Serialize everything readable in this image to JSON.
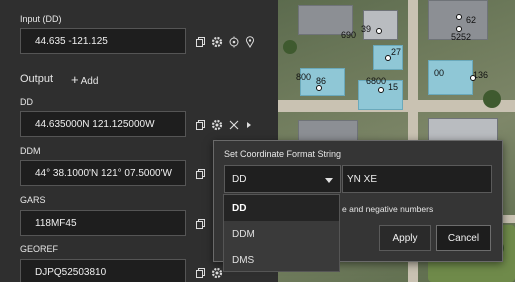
{
  "input": {
    "label": "Input (DD)",
    "value": "44.635 -121.125"
  },
  "output": {
    "title": "Output",
    "add_label": "Add",
    "items": [
      {
        "label": "DD",
        "value": "44.635000N 121.125000W"
      },
      {
        "label": "DDM",
        "value": "44° 38.1000'N 121° 07.5000'W"
      },
      {
        "label": "GARS",
        "value": "118MF45"
      },
      {
        "label": "GEOREF",
        "value": "DJPQ52503810"
      }
    ]
  },
  "popup": {
    "title": "Set Coordinate Format String",
    "selected_format": "DD",
    "format_string": "YN XE",
    "negative_text": "e and negative numbers",
    "apply_label": "Apply",
    "cancel_label": "Cancel",
    "options": [
      "DD",
      "DDM",
      "DMS"
    ]
  },
  "map": {
    "labels": [
      "690",
      "39",
      "27",
      "52",
      "52",
      "62",
      "800",
      "86",
      "15",
      "6800",
      "00",
      "136"
    ]
  },
  "icons": {
    "copy": "copy-icon",
    "gear": "gear-icon",
    "locate": "locate-icon",
    "pin": "pin-icon",
    "close": "close-icon",
    "chevron": "chevron-right-icon"
  }
}
